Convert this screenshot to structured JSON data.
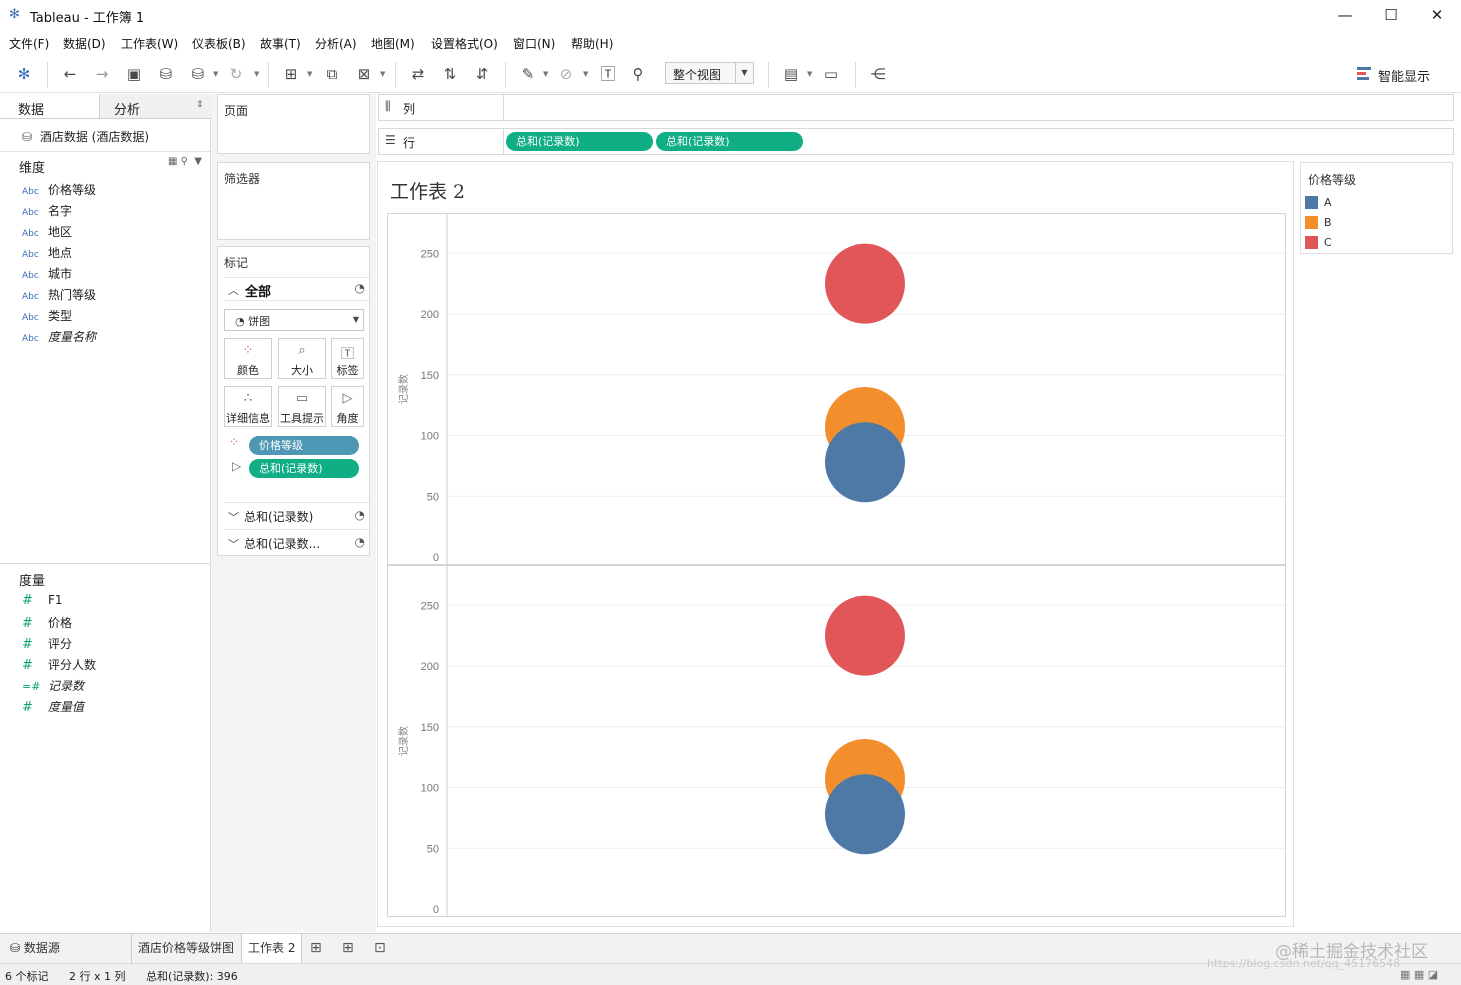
{
  "window": {
    "title": "Tableau - 工作簿 1",
    "minimize": "—",
    "maximize": "☐",
    "close": "✕"
  },
  "menu": [
    "文件(F)",
    "数据(D)",
    "工作表(W)",
    "仪表板(B)",
    "故事(T)",
    "分析(A)",
    "地图(M)",
    "设置格式(O)",
    "窗口(N)",
    "帮助(H)"
  ],
  "toolbar": {
    "fit_label": "整个视图",
    "show_me": "智能显示"
  },
  "data_pane": {
    "tab_data": "数据",
    "tab_analysis": "分析",
    "datasource": "酒店数据 (酒店数据)",
    "dimensions_title": "维度",
    "dimensions": [
      {
        "type": "Abc",
        "name": "价格等级"
      },
      {
        "type": "Abc",
        "name": "名字"
      },
      {
        "type": "Abc",
        "name": "地区"
      },
      {
        "type": "Abc",
        "name": "地点"
      },
      {
        "type": "Abc",
        "name": "城市"
      },
      {
        "type": "Abc",
        "name": "热门等级"
      },
      {
        "type": "Abc",
        "name": "类型"
      },
      {
        "type": "Abc",
        "name": "度量名称"
      }
    ],
    "measures_title": "度量",
    "measures": [
      {
        "type": "#",
        "name": "F1"
      },
      {
        "type": "#",
        "name": "价格"
      },
      {
        "type": "#",
        "name": "评分"
      },
      {
        "type": "#",
        "name": "评分人数"
      },
      {
        "type": "=#",
        "name": "记录数"
      },
      {
        "type": "#",
        "name": "度量值"
      }
    ]
  },
  "shelves": {
    "pages": "页面",
    "filters": "筛选器",
    "marks": "标记",
    "marks_all": "全部",
    "mark_type": "饼图",
    "mark_buttons": [
      "颜色",
      "大小",
      "标签",
      "详细信息",
      "工具提示",
      "角度"
    ],
    "mark_pills": [
      "价格等级",
      "总和(记录数)"
    ],
    "mark_cards": [
      "总和(记录数)",
      "总和(记录数..."
    ],
    "columns_label": "列",
    "rows_label": "行",
    "row_pills": [
      "总和(记录数)",
      "总和(记录数)"
    ]
  },
  "view": {
    "sheet_title": "工作表 2"
  },
  "legend": {
    "title": "价格等级",
    "items": [
      {
        "label": "A",
        "color": "#4e79a7"
      },
      {
        "label": "B",
        "color": "#f28e2b"
      },
      {
        "label": "C",
        "color": "#e15759"
      }
    ]
  },
  "chart_data": [
    {
      "type": "scatter",
      "mark": "pie",
      "ylabel": "记录数",
      "ylim": [
        0,
        270
      ],
      "yticks": [
        0,
        50,
        100,
        150,
        200,
        250
      ],
      "series": [
        {
          "name": "A",
          "values": [
            78
          ],
          "color": "#4e79a7"
        },
        {
          "name": "B",
          "values": [
            107
          ],
          "color": "#f28e2b"
        },
        {
          "name": "C",
          "values": [
            225
          ],
          "color": "#e15759"
        }
      ]
    },
    {
      "type": "scatter",
      "mark": "pie",
      "ylabel": "记录数",
      "ylim": [
        0,
        270
      ],
      "yticks": [
        0,
        50,
        100,
        150,
        200,
        250
      ],
      "series": [
        {
          "name": "A",
          "values": [
            78
          ],
          "color": "#4e79a7"
        },
        {
          "name": "B",
          "values": [
            107
          ],
          "color": "#f28e2b"
        },
        {
          "name": "C",
          "values": [
            225
          ],
          "color": "#e15759"
        }
      ]
    }
  ],
  "tabs": {
    "datasource": "数据源",
    "sheet1": "酒店价格等级饼图",
    "sheet2": "工作表 2"
  },
  "status": {
    "marks": "6 个标记",
    "dims": "2 行 x 1 列",
    "sum": "总和(记录数): 396"
  },
  "watermark": "@稀土掘金技术社区",
  "watermark_url": "https://blog.csdn.net/qq_45176548"
}
